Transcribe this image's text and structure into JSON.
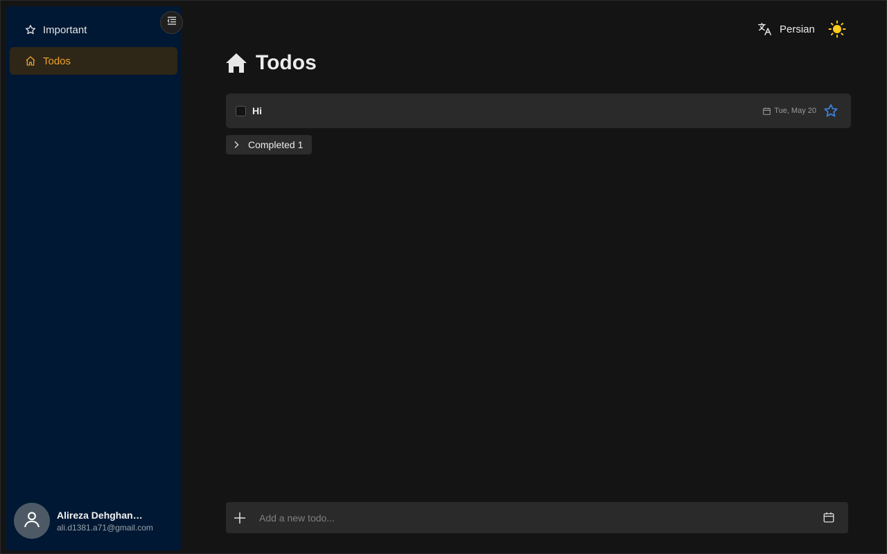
{
  "sidebar": {
    "items": [
      {
        "label": "Important",
        "icon": "star-icon"
      },
      {
        "label": "Todos",
        "icon": "home-icon",
        "active": true
      }
    ],
    "collapse_icon": "menu-collapse-icon",
    "profile": {
      "name": "Alireza Dehghan…",
      "email": "ali.d1381.a71@gmail.com",
      "avatar_icon": "user-icon"
    }
  },
  "header": {
    "language_label": "Persian",
    "language_icon": "translate-icon",
    "theme_icon": "sun-icon"
  },
  "main": {
    "title": "Todos",
    "title_icon": "home-icon",
    "todos": [
      {
        "title": "Hi",
        "date": "Tue, May 20",
        "important": false
      }
    ],
    "completed_label": "Completed 1",
    "add_placeholder": "Add a new todo..."
  },
  "colors": {
    "background": "#141414",
    "sidebar": "#001833",
    "accent": "#f0a12c",
    "star": "#3d7fd6",
    "sun": "#ffcc1a"
  }
}
